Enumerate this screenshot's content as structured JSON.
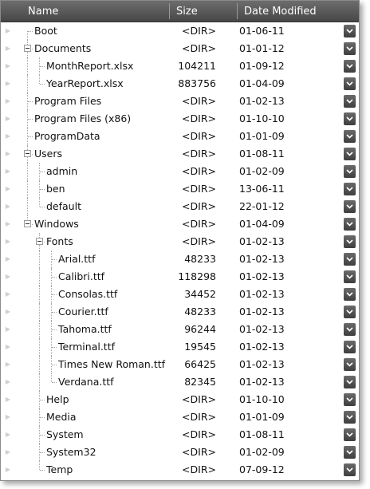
{
  "header": {
    "name": "Name",
    "size": "Size",
    "date_modified": "Date Modified"
  },
  "rows": [
    {
      "name": "Boot",
      "size": "<DIR>",
      "date": "01-06-11",
      "level": 0,
      "expander": false
    },
    {
      "name": "Documents",
      "size": "<DIR>",
      "date": "01-01-12",
      "level": 0,
      "expander": true
    },
    {
      "name": "MonthReport.xlsx",
      "size": "104211",
      "date": "01-09-12",
      "level": 1,
      "expander": false
    },
    {
      "name": "YearReport.xlsx",
      "size": "883756",
      "date": "01-04-09",
      "level": 1,
      "expander": false
    },
    {
      "name": "Program Files",
      "size": "<DIR>",
      "date": "01-02-13",
      "level": 0,
      "expander": false
    },
    {
      "name": "Program Files (x86)",
      "size": "<DIR>",
      "date": "01-10-10",
      "level": 0,
      "expander": false
    },
    {
      "name": "ProgramData",
      "size": "<DIR>",
      "date": "01-01-09",
      "level": 0,
      "expander": false
    },
    {
      "name": "Users",
      "size": "<DIR>",
      "date": "01-08-11",
      "level": 0,
      "expander": true
    },
    {
      "name": "admin",
      "size": "<DIR>",
      "date": "01-02-09",
      "level": 1,
      "expander": false
    },
    {
      "name": "ben",
      "size": "<DIR>",
      "date": "13-06-11",
      "level": 1,
      "expander": false
    },
    {
      "name": "default",
      "size": "<DIR>",
      "date": "22-01-12",
      "level": 1,
      "expander": false
    },
    {
      "name": "Windows",
      "size": "<DIR>",
      "date": "01-04-09",
      "level": 0,
      "expander": true
    },
    {
      "name": "Fonts",
      "size": "<DIR>",
      "date": "01-02-13",
      "level": 1,
      "expander": true
    },
    {
      "name": "Arial.ttf",
      "size": "48233",
      "date": "01-02-13",
      "level": 2,
      "expander": false
    },
    {
      "name": "Calibri.ttf",
      "size": "118298",
      "date": "01-02-13",
      "level": 2,
      "expander": false
    },
    {
      "name": "Consolas.ttf",
      "size": "34452",
      "date": "01-02-13",
      "level": 2,
      "expander": false
    },
    {
      "name": "Courier.ttf",
      "size": "48233",
      "date": "01-02-13",
      "level": 2,
      "expander": false
    },
    {
      "name": "Tahoma.ttf",
      "size": "96244",
      "date": "01-02-13",
      "level": 2,
      "expander": false
    },
    {
      "name": "Terminal.ttf",
      "size": "19545",
      "date": "01-02-13",
      "level": 2,
      "expander": false
    },
    {
      "name": "Times New Roman.ttf",
      "size": "66425",
      "date": "01-02-13",
      "level": 2,
      "expander": false
    },
    {
      "name": "Verdana.ttf",
      "size": "82345",
      "date": "01-02-13",
      "level": 2,
      "expander": false
    },
    {
      "name": "Help",
      "size": "<DIR>",
      "date": "01-10-10",
      "level": 1,
      "expander": false
    },
    {
      "name": "Media",
      "size": "<DIR>",
      "date": "01-01-09",
      "level": 1,
      "expander": false
    },
    {
      "name": "System",
      "size": "<DIR>",
      "date": "01-08-11",
      "level": 1,
      "expander": false
    },
    {
      "name": "System32",
      "size": "<DIR>",
      "date": "01-02-09",
      "level": 1,
      "expander": false
    },
    {
      "name": "Temp",
      "size": "<DIR>",
      "date": "07-09-12",
      "level": 1,
      "expander": false
    }
  ],
  "icons": {
    "row_arrow": "row-arrow-icon",
    "dropdown": "chevron-down-icon",
    "expander": "collapse-minus-icon"
  },
  "colors": {
    "header_top": "#6d6d6d",
    "header_bottom": "#474747",
    "dropdown": "#4a4a4a"
  }
}
